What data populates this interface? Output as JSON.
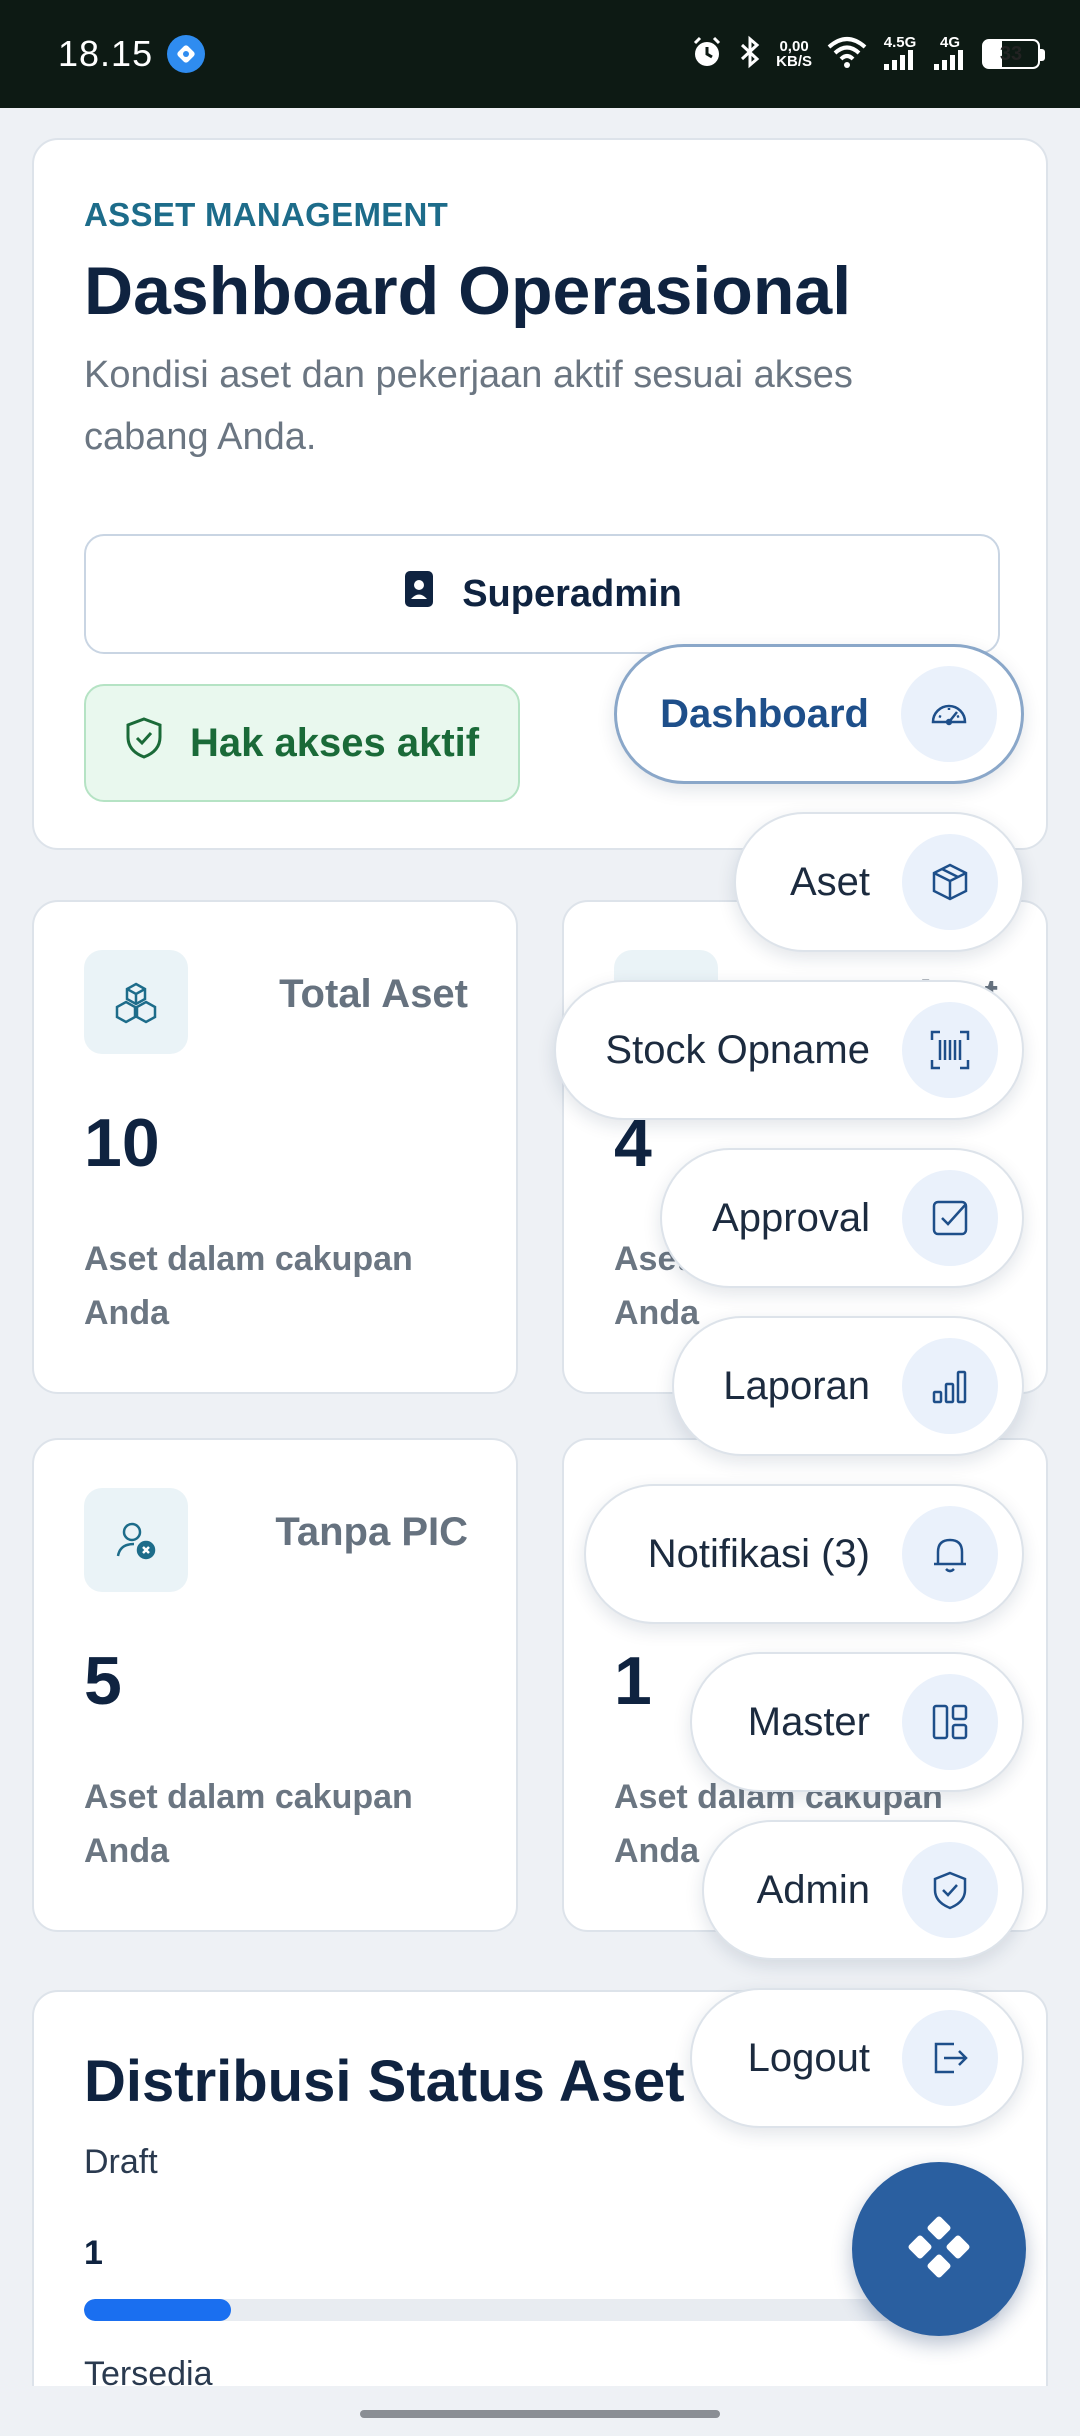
{
  "status_bar": {
    "time": "18.15",
    "net_speed_value": "0,00",
    "net_speed_unit": "KB/S",
    "network_1": "4.5G",
    "network_2": "4G",
    "battery": "33",
    "battery_level": 0.33
  },
  "hero": {
    "eyebrow": "ASSET MANAGEMENT",
    "title": "Dashboard Operasional",
    "subtitle": "Kondisi aset dan pekerjaan aktif sesuai akses cabang Anda.",
    "role_label": "Superadmin",
    "access_label": "Hak akses aktif"
  },
  "stats": [
    {
      "label": "Total Aset",
      "value": "10",
      "desc": "Aset dalam cakupan Anda",
      "icon": "cubes-icon"
    },
    {
      "label": "Aset",
      "value": "4",
      "desc": "Aset dalam cakupan Anda",
      "icon": "box-icon"
    },
    {
      "label": "Tanpa PIC",
      "value": "5",
      "desc": "Aset dalam cakupan Anda",
      "icon": "user-x-icon"
    },
    {
      "label": "",
      "value": "1",
      "desc": "Aset dalam cakupan Anda",
      "icon": ""
    }
  ],
  "distribution": {
    "title": "Distribusi Status Aset",
    "first_label": "Draft",
    "first_count": "1",
    "first_fraction": 0.16,
    "next_label": "Tersedia"
  },
  "fab_menu": {
    "items": [
      {
        "label": "Dashboard",
        "icon": "gauge-icon",
        "active": true
      },
      {
        "label": "Aset",
        "icon": "box-icon",
        "active": false
      },
      {
        "label": "Stock Opname",
        "icon": "barcode-scan-icon",
        "active": false
      },
      {
        "label": "Approval",
        "icon": "check-square-icon",
        "active": false
      },
      {
        "label": "Laporan",
        "icon": "bar-chart-icon",
        "active": false
      },
      {
        "label": "Notifikasi (3)",
        "icon": "bell-icon",
        "active": false
      },
      {
        "label": "Master",
        "icon": "layout-icon",
        "active": false
      },
      {
        "label": "Admin",
        "icon": "shield-check-icon",
        "active": false
      },
      {
        "label": "Logout",
        "icon": "logout-icon",
        "active": false
      }
    ]
  },
  "colors": {
    "accent": "#2a5fa0",
    "eyebrow": "#1d6c8a",
    "success_bg": "#e9f8ee",
    "success_text": "#1a6a38",
    "progress": "#1a6ff0"
  }
}
